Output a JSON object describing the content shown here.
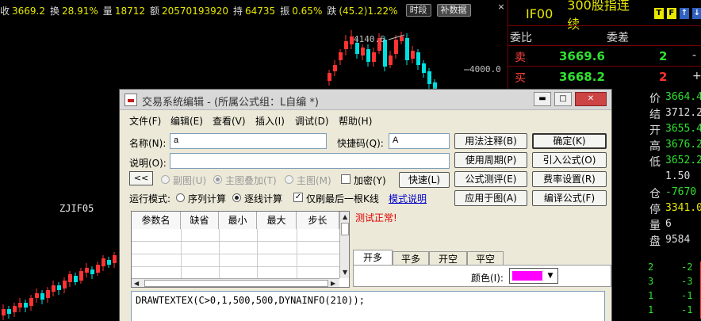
{
  "status_bar": {
    "items": [
      {
        "label": "收",
        "value": "3669.2",
        "color": "yellow"
      },
      {
        "label": "换",
        "value": "28.91%",
        "color": "yellow"
      },
      {
        "label": "量",
        "value": "18712",
        "color": "yellow"
      },
      {
        "label": "额",
        "value": "20570193920",
        "color": "yellow"
      },
      {
        "label": "持",
        "value": "64735",
        "color": "yellow"
      },
      {
        "label": "振",
        "value": "0.65%",
        "color": "yellow"
      },
      {
        "label": "跌",
        "value": "(45.2)1.22%",
        "color": "yellow"
      }
    ],
    "btn_timeframe": "时段",
    "btn_supplement": "补数据",
    "close": "×"
  },
  "chart": {
    "high_label": "4140.6",
    "axis_label": "4000.0",
    "indicator": "ZJIF05",
    "colors": {
      "up": "#ff3333",
      "down": "#00e0e0"
    }
  },
  "quote": {
    "code": "IF00",
    "name": "300股指连续",
    "icons": [
      "T",
      "F",
      "↑",
      "↓"
    ],
    "order_ratio_label": "委比",
    "order_diff_label": "委差",
    "sell_label": "卖",
    "sell_price": "3669.6",
    "sell_vol": "2",
    "sell_dash": "-",
    "buy_label": "买",
    "buy_price": "3668.2",
    "buy_vol": "2",
    "buy_dash": "+",
    "fields": [
      {
        "label": "价",
        "value": "3664.4",
        "color": "#30e030"
      },
      {
        "label": "结",
        "value": "3712.2",
        "color": "#ddd"
      },
      {
        "label": "开",
        "value": "3655.4",
        "color": "#30e030"
      },
      {
        "label": "高",
        "value": "3676.2",
        "color": "#30e030"
      },
      {
        "label": "低",
        "value": "3652.2",
        "color": "#30e030"
      },
      {
        "label": "",
        "value": "1.50",
        "color": "#ddd"
      },
      {
        "label": "仓",
        "value": "-7670",
        "color": "#30e030"
      },
      {
        "label": "停",
        "value": "3341.0",
        "color": "#e8e800"
      },
      {
        "label": "量",
        "value": "6",
        "color": "#ddd"
      },
      {
        "label": "盘",
        "value": "9584",
        "color": "#ddd"
      }
    ],
    "ticks": [
      {
        "a": "2",
        "b": "-2"
      },
      {
        "a": "3",
        "b": "-3"
      },
      {
        "a": "1",
        "b": "-1"
      },
      {
        "a": "1",
        "b": "-1"
      }
    ]
  },
  "dialog": {
    "title": "交易系统编辑 - (所属公式组：L自编 *)",
    "menu": [
      "文件(F)",
      "编辑(E)",
      "查看(V)",
      "插入(I)",
      "调试(D)",
      "帮助(H)"
    ],
    "name_label": "名称(N):",
    "name_value": "a",
    "shortcut_label": "快捷码(Q):",
    "shortcut_value": "A",
    "desc_label": "说明(O):",
    "desc_value": "",
    "back_btn": "<<",
    "opt_subchart": "副图(U)",
    "opt_overlay": "主图叠加(T)",
    "opt_main": "主图(M)",
    "opt_encrypt": "加密(Y)",
    "btn_fast": "快速(L)",
    "run_mode_label": "运行模式:",
    "run_seq": "序列计算",
    "run_line": "逐线计算",
    "run_last": "仅刷最后一根K线",
    "mode_help": "模式说明",
    "param_headers": [
      "参数名",
      "缺省",
      "最小",
      "最大",
      "步长"
    ],
    "test_result": "测试正常!",
    "tabs": [
      "开多",
      "平多",
      "开空",
      "平空"
    ],
    "color_label": "颜色(I):",
    "color_value": "#ff00ff",
    "buttons_left": [
      "用法注释(B)",
      "使用周期(P)",
      "公式测评(E)",
      "应用于图(A)"
    ],
    "buttons_right": [
      "确定(K)",
      "引入公式(O)",
      "费率设置(R)",
      "编译公式(F)"
    ],
    "code": "DRAWTEXTEX(C>0,1,500,500,DYNAINFO(210));"
  }
}
